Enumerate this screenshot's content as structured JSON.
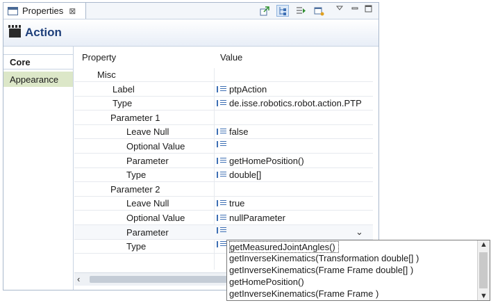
{
  "view": {
    "tab_label": "Properties",
    "close_glyph": "⊠",
    "icons": [
      "pin-icon",
      "tree-icon",
      "filter-icon",
      "new-window-icon",
      "view-menu-icon",
      "minimize-icon",
      "maximize-icon"
    ]
  },
  "title": {
    "text": "Action",
    "icon": "clapperboard-icon"
  },
  "left_tabs": {
    "core": "Core",
    "appearance": "Appearance"
  },
  "grid": {
    "header_property": "Property",
    "header_value": "Value",
    "rows": [
      {
        "key": "Misc",
        "value": null
      },
      {
        "key": "Label",
        "value": "ptpAction"
      },
      {
        "key": "Type",
        "value": "de.isse.robotics.robot.action.PTP"
      },
      {
        "key": "Parameter 1",
        "value": null
      },
      {
        "key": "Leave Null",
        "value": "false"
      },
      {
        "key": "Optional Value",
        "value": ""
      },
      {
        "key": "Parameter",
        "value": "getHomePosition()"
      },
      {
        "key": "Type",
        "value": "double[]"
      },
      {
        "key": "Parameter 2",
        "value": null
      },
      {
        "key": "Leave Null",
        "value": "true"
      },
      {
        "key": "Optional Value",
        "value": "nullParameter"
      },
      {
        "key": "Parameter",
        "value": ""
      },
      {
        "key": "Type",
        "value": ""
      }
    ]
  },
  "dropdown": {
    "items": [
      "getMeasuredJointAngles()",
      "getInverseKinematics(Transformation double[] )",
      "getInverseKinematics(Frame Frame double[] )",
      "getHomePosition()",
      "getInverseKinematics(Frame Frame )"
    ],
    "selected_index": 0
  },
  "glyphs": {
    "chevron_down": "⌄",
    "scroll_left": "‹",
    "scroll_up": "▲",
    "scroll_down": "▼"
  }
}
